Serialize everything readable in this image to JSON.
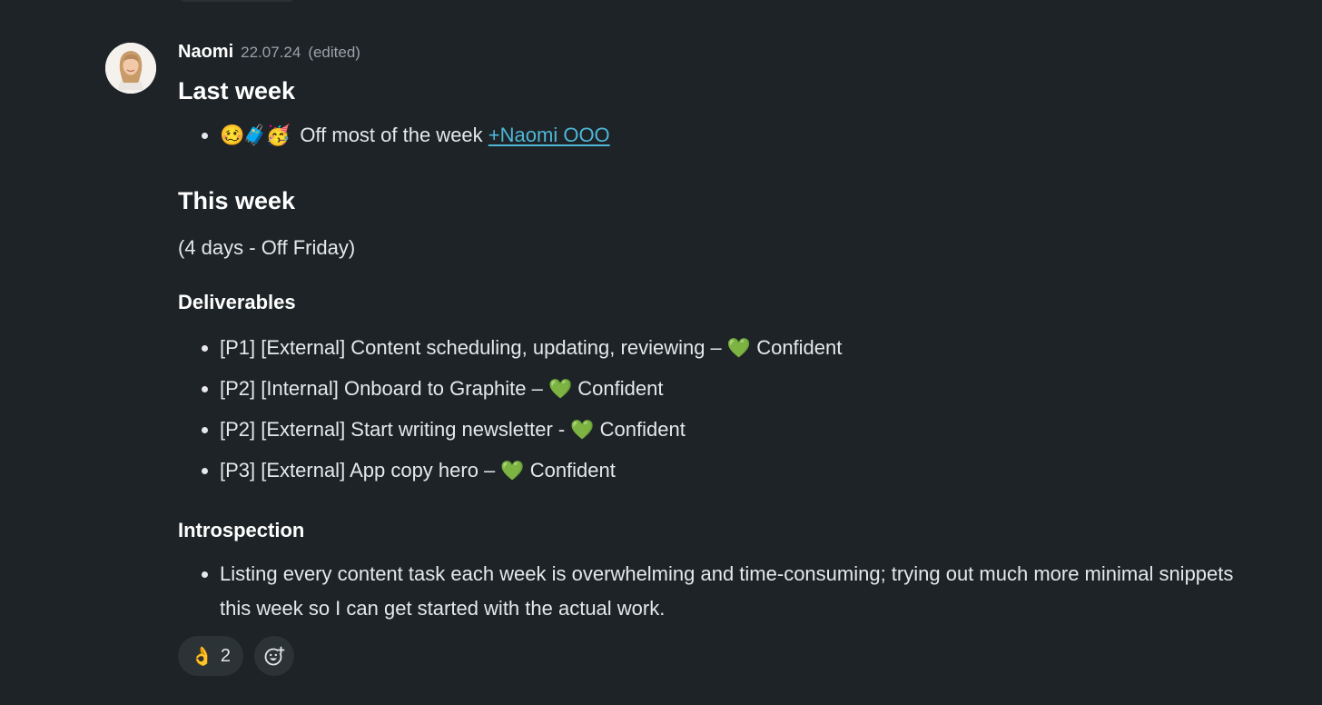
{
  "message": {
    "author": "Naomi",
    "date": "22.07.24",
    "edited_label": "(edited)",
    "avatar_icon": "person-avatar",
    "last_week": {
      "heading": "Last week",
      "items": [
        {
          "emojis": "🥴🧳🥳",
          "text": "Off most of the week",
          "link": "+Naomi OOO"
        }
      ]
    },
    "this_week": {
      "heading": "This week",
      "note": "(4 days - Off Friday)"
    },
    "deliverables": {
      "heading": "Deliverables",
      "status_icon": "💚",
      "items": [
        {
          "text": "[P1] [External] Content scheduling, updating, reviewing –",
          "status": "Confident"
        },
        {
          "text": "[P2] [Internal] Onboard to Graphite –",
          "status": "Confident"
        },
        {
          "text": "[P2] [External] Start writing newsletter -",
          "status": "Confident"
        },
        {
          "text": "[P3] [External] App copy hero –",
          "status": "Confident"
        }
      ]
    },
    "introspection": {
      "heading": "Introspection",
      "items": [
        {
          "text": "Listing every content task each week is overwhelming and time-consuming; trying out much more minimal snippets this week so I can get started with the actual work."
        }
      ]
    }
  },
  "reactions": [
    {
      "emoji": "👌",
      "count": "2"
    }
  ],
  "add_reaction_icon": "add-emoji-icon"
}
